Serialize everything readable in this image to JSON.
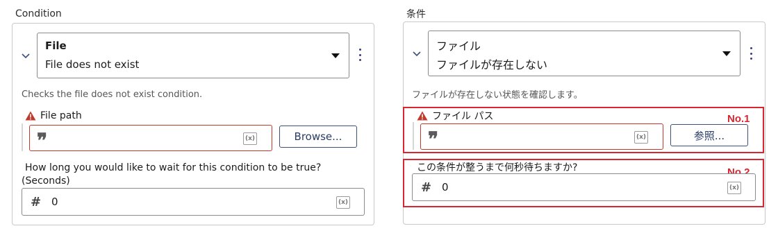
{
  "left": {
    "section_label": "Condition",
    "select": {
      "line1": "File",
      "line2": "File does not exist"
    },
    "description": "Checks the file does not exist condition.",
    "file_path_label": "File path",
    "file_path_value": "",
    "browse_label": "Browse...",
    "wait_label_line1": "How long you would like to wait for this condition to be true?",
    "wait_label_line2": "(Seconds)",
    "wait_value": "0",
    "var_glyph": "(x)"
  },
  "right": {
    "section_label": "条件",
    "select": {
      "line1": "ファイル",
      "line2": "ファイルが存在しない"
    },
    "description": "ファイルが存在しない状態を確認します。",
    "file_path_label": "ファイル パス",
    "file_path_value": "",
    "browse_label": "参照...",
    "wait_label": "この条件が整うまで何秒待ちますか?",
    "wait_value": "0",
    "var_glyph": "(x)",
    "annotations": {
      "no1": "No.1",
      "no2": "No.2"
    }
  },
  "icons": {
    "warning": "warning-triangle-icon",
    "quote": "quote-icon",
    "hash": "number-hash-icon",
    "chevron": "chevron-down-icon",
    "kebab": "more-vertical-icon",
    "caret": "dropdown-caret-icon",
    "variable": "variable-x-icon"
  },
  "colors": {
    "accent": "#2a3d66",
    "error": "#c0392b",
    "annotation": "#d9252f"
  }
}
